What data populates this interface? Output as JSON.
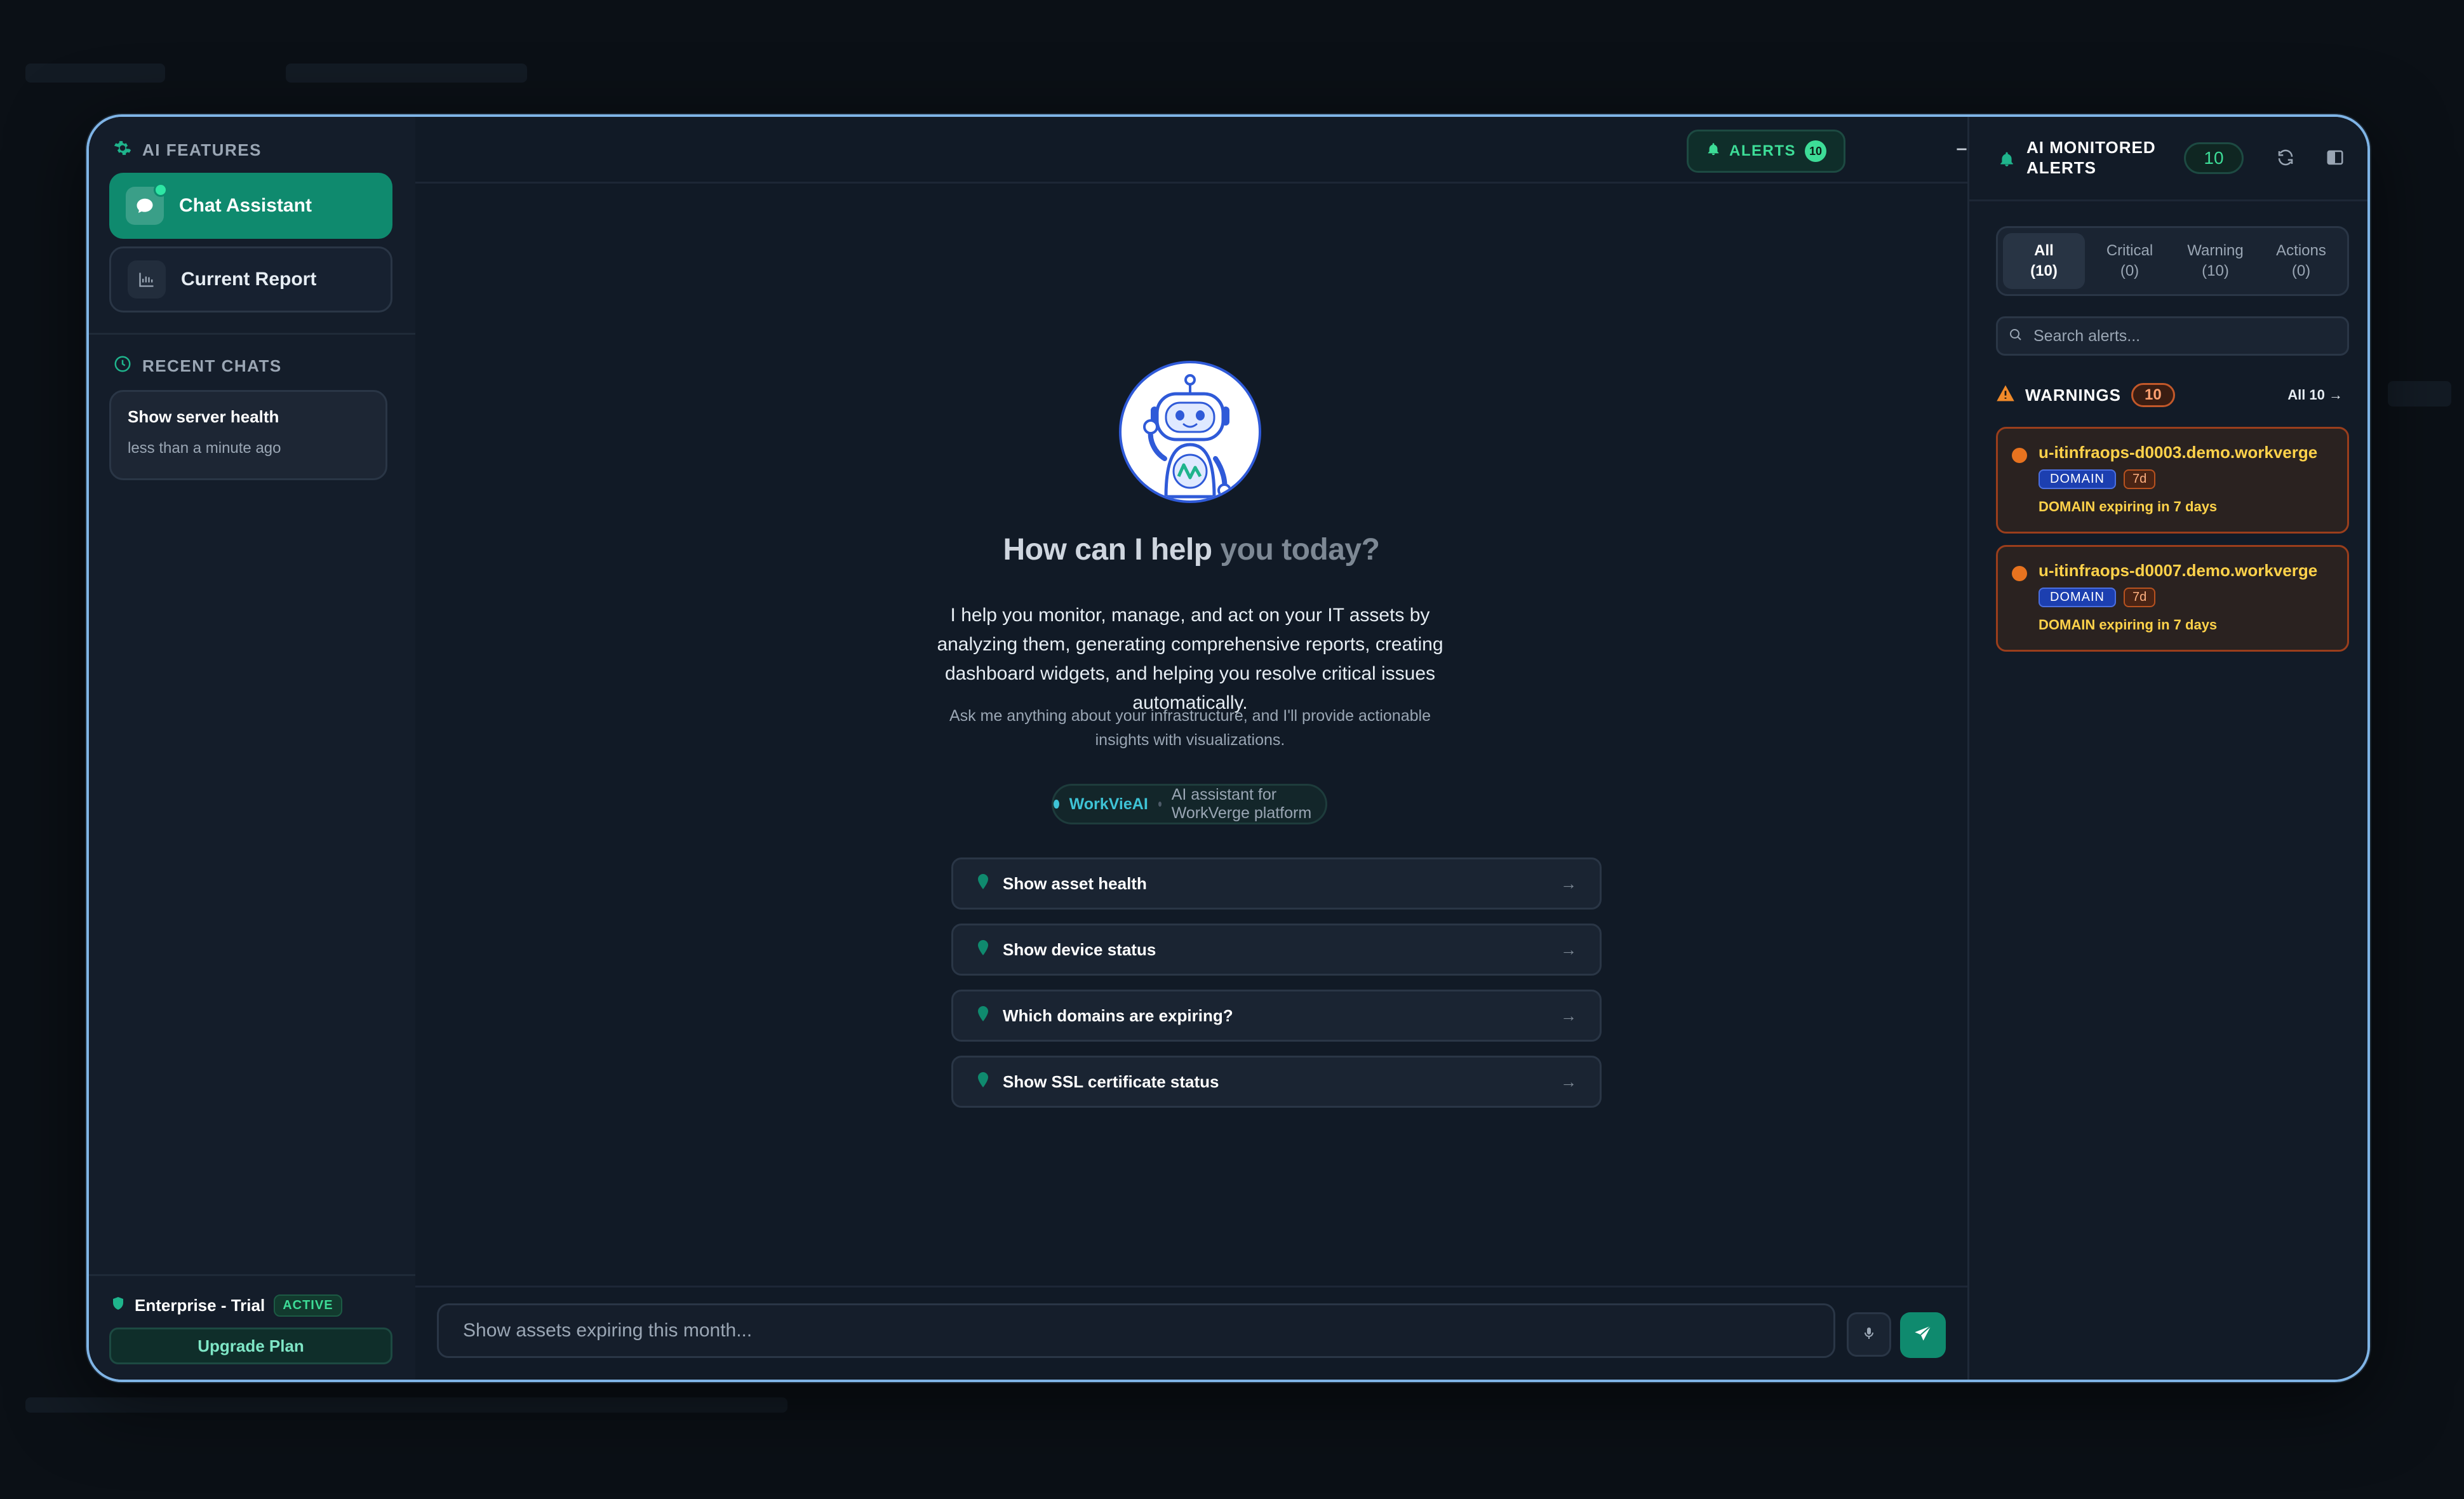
{
  "sidebar": {
    "section_title": "AI FEATURES",
    "features": [
      {
        "label": "Chat Assistant",
        "icon": "chat-bubble-icon"
      },
      {
        "label": "Current Report",
        "icon": "bar-chart-icon"
      }
    ],
    "recent_title": "RECENT CHATS",
    "recent_chats": [
      {
        "title": "Show server health",
        "time": "less than a minute ago"
      }
    ],
    "plan": {
      "name": "Enterprise - Trial",
      "status": "ACTIVE",
      "upgrade_label": "Upgrade Plan"
    }
  },
  "header": {
    "alerts_label": "ALERTS",
    "alerts_count": "10"
  },
  "main": {
    "title_strong": "How can I help",
    "title_fade": "you today?",
    "description": "I help you monitor, manage, and act on your IT assets by analyzing them, generating comprehensive reports, creating dashboard widgets, and helping you resolve critical issues automatically.",
    "subtitle": "Ask me anything about your infrastructure, and I'll provide actionable insights with visualizations.",
    "brand": "WorkVieAI",
    "brand_tagline": "AI assistant for WorkVerge platform",
    "suggestions": [
      "Show asset health",
      "Show device status",
      "Which domains are expiring?",
      "Show SSL certificate status"
    ],
    "input_placeholder": "Show assets expiring this month..."
  },
  "alerts_panel": {
    "title": "AI MONITORED ALERTS",
    "count": "10",
    "tabs": [
      {
        "label": "All",
        "count": "(10)"
      },
      {
        "label": "Critical",
        "count": "(0)"
      },
      {
        "label": "Warning",
        "count": "(10)"
      },
      {
        "label": "Actions",
        "count": "(0)"
      }
    ],
    "search_placeholder": "Search alerts...",
    "warnings_label": "WARNINGS",
    "warnings_count": "10",
    "all_link": "All 10 →",
    "items": [
      {
        "name": "u-itinfraops-d0003.demo.workverge",
        "type": "DOMAIN",
        "days": "7d",
        "message": "DOMAIN expiring in 7 days"
      },
      {
        "name": "u-itinfraops-d0007.demo.workverge",
        "type": "DOMAIN",
        "days": "7d",
        "message": "DOMAIN expiring in 7 days"
      }
    ]
  },
  "colors": {
    "accent": "#0f8a6e",
    "accent_text": "#3ddc97",
    "warning_border": "#9a3e1c",
    "warning_text": "#ffd24a",
    "modal_border": "#7fb4e6"
  }
}
